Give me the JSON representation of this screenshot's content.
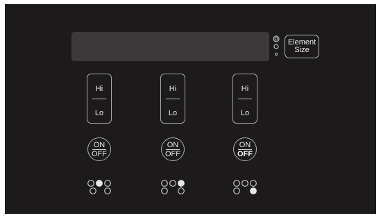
{
  "element_size": {
    "line1": "Element",
    "line2": "Size"
  },
  "burners": [
    {
      "hi_label": "Hi",
      "lo_label": "Lo",
      "on_label": "ON",
      "off_label": "OFF",
      "filled_dot": "top-middle"
    },
    {
      "hi_label": "Hi",
      "lo_label": "Lo",
      "on_label": "ON",
      "off_label": "OFF",
      "filled_dot": "top-right"
    },
    {
      "hi_label": "Hi",
      "lo_label": "Lo",
      "on_label": "ON",
      "off_label": "OFF",
      "filled_dot": "bottom-right"
    }
  ],
  "colors": {
    "panel": "#1c1a1a",
    "display": "#3b3939",
    "outline": "#b0b0b0",
    "dot_filled": "#e6e6e6"
  }
}
